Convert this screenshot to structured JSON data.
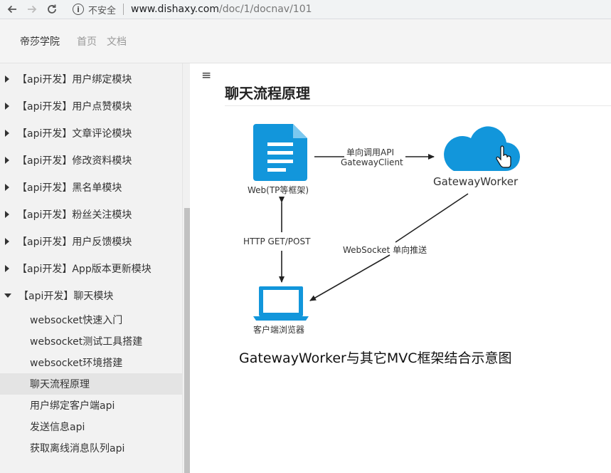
{
  "browser": {
    "security_label": "不安全",
    "url_host": "www.dishaxy.com",
    "url_path": "/doc/1/docnav/101",
    "info_glyph": "i"
  },
  "header": {
    "brand": "帝莎学院",
    "nav": [
      "首页",
      "文档"
    ]
  },
  "sidebar": {
    "sections": [
      {
        "label": "【api开发】用户绑定模块",
        "expanded": false
      },
      {
        "label": "【api开发】用户点赞模块",
        "expanded": false
      },
      {
        "label": "【api开发】文章评论模块",
        "expanded": false
      },
      {
        "label": "【api开发】修改资料模块",
        "expanded": false
      },
      {
        "label": "【api开发】黑名单模块",
        "expanded": false
      },
      {
        "label": "【api开发】粉丝关注模块",
        "expanded": false
      },
      {
        "label": "【api开发】用户反馈模块",
        "expanded": false
      },
      {
        "label": "【api开发】App版本更新模块",
        "expanded": false
      },
      {
        "label": "【api开发】聊天模块",
        "expanded": true
      }
    ],
    "subitems": [
      {
        "label": "websocket快速入门",
        "active": false
      },
      {
        "label": "websocket测试工具搭建",
        "active": false
      },
      {
        "label": "websocket环境搭建",
        "active": false
      },
      {
        "label": "聊天流程原理",
        "active": true
      },
      {
        "label": "用户绑定客户端api",
        "active": false
      },
      {
        "label": "发送信息api",
        "active": false
      },
      {
        "label": "获取离线消息队列api",
        "active": false
      }
    ]
  },
  "main": {
    "menu_glyph": "≡",
    "title": "聊天流程原理",
    "diagram": {
      "web_label": "Web(TP等框架)",
      "gateway_label": "GatewayWorker",
      "client_label": "客户端浏览器",
      "arrow_api_line1": "单向调用API",
      "arrow_api_line2": "GatewayClient",
      "arrow_http": "HTTP GET/POST",
      "arrow_ws": "WebSocket 单向推送",
      "caption": "GatewayWorker与其它MVC框架结合示意图",
      "accent_color": "#1296db"
    }
  }
}
